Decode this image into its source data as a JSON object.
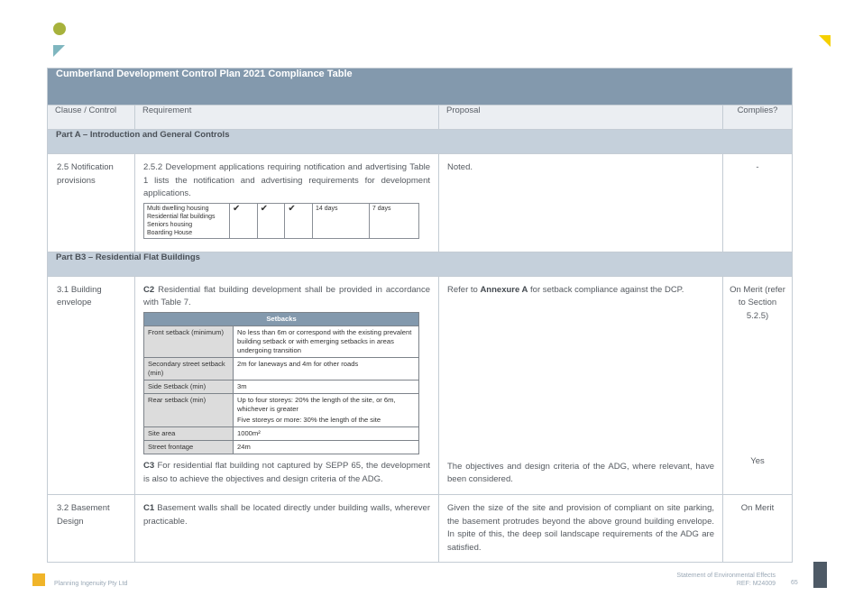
{
  "table_title": "Cumberland Development Control Plan 2021 Compliance Table",
  "headers": {
    "clause": "Clause / Control",
    "requirement": "Requirement",
    "proposal": "Proposal",
    "complies": "Complies?"
  },
  "section_a": "Part A – Introduction and General Controls",
  "row_25": {
    "clause": "2.5 Notification provisions",
    "requirement": "2.5.2 Development applications requiring notification and advertising Table 1 lists the notification and advertising requirements for development applications.",
    "proposal": "Noted.",
    "complies": "-",
    "notif_table": {
      "types": "Multi dwelling housing\nResidential flat buildings\nSeniors housing\nBoarding House",
      "c1": "✔",
      "c2": "✔",
      "c3": "✔",
      "c4": "14 days",
      "c5": "7 days"
    }
  },
  "section_b3": "Part B3 –  Residential Flat Buildings",
  "row_31": {
    "clause": "3.1 Building envelope",
    "c2_code": "C2",
    "c2_text": " Residential flat building development shall be provided in accordance with Table 7.",
    "proposal_pre": "Refer to ",
    "proposal_bold": "Annexure A",
    "proposal_post": " for setback compliance against the DCP.",
    "complies_1": "On Merit (refer to Section 5.2.5)",
    "setbacks": {
      "header": "Setbacks",
      "front_label": "Front setback (minimum)",
      "front_value": "No less than 6m or correspond with the existing prevalent building setback or with emerging setbacks in areas undergoing transition",
      "secondary_label": "Secondary street setback (min)",
      "secondary_value": "2m for laneways and 4m for other roads",
      "side_label": "Side Setback (min)",
      "side_value": "3m",
      "rear_label": "Rear setback (min)",
      "rear_value_1": "Up to four storeys: 20% the length of the site, or 6m, whichever is greater",
      "rear_value_2": "Five storeys or more: 30% the length of the site",
      "site_area_label": "Site area",
      "site_area_value": "1000m²",
      "frontage_label": "Street frontage",
      "frontage_value": "24m"
    },
    "c3_code": "C3",
    "c3_text": " For residential flat building not captured by SEPP 65, the development is also to achieve the objectives and design criteria of the ADG.",
    "proposal_2": "The objectives and design criteria of the ADG, where relevant, have been considered.",
    "complies_2": "Yes"
  },
  "row_32": {
    "clause": "3.2 Basement Design",
    "c1_code": "C1",
    "c1_text": " Basement walls shall be located directly under building walls, wherever practicable.",
    "proposal": "Given the size of the site and provision of compliant on site parking, the basement protrudes beyond the above ground building envelope. In spite of this, the deep soil landscape requirements of the ADG are satisfied.",
    "complies": "On Merit"
  },
  "footer": {
    "company": "Planning Ingenuity Pty Ltd",
    "doc_title": "Statement of Environmental Effects",
    "ref": "REF: M24009",
    "page": "65"
  },
  "colors": {
    "title_bar": "#8399ad",
    "section_bar": "#c5d0db",
    "header_bar": "#ebeef2",
    "logo_green": "#a7b23c",
    "logo_teal": "#7fb6bf",
    "accent_yellow": "#f5d000",
    "footer_orange": "#f0b429",
    "footer_dark": "#4e5a66"
  }
}
